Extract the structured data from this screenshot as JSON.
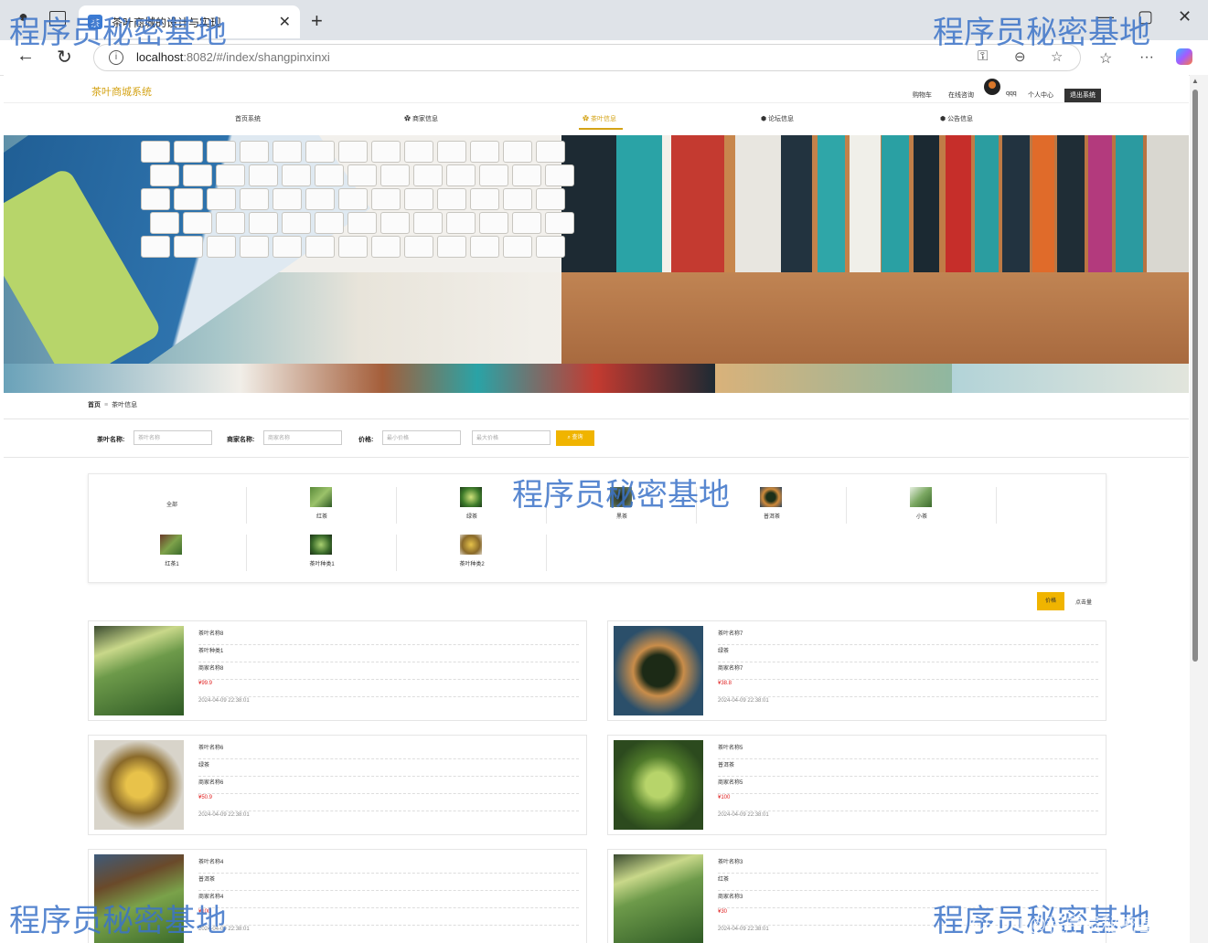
{
  "browser": {
    "tab_title": "茶叶商城的设计与实现",
    "url_host": "localhost",
    "url_rest": ":8082/#/index/shangpinxinxi"
  },
  "site": {
    "title": "茶叶商城系统",
    "top_links": [
      "购物车",
      "在线咨询",
      "qqq",
      "个人中心"
    ],
    "logout": "退出系统",
    "menu": [
      "首页系统",
      "商家信息",
      "茶叶信息",
      "论坛信息",
      "公告信息"
    ],
    "active_menu": "茶叶信息"
  },
  "breadcrumb": {
    "home": "首页",
    "sep": "≡",
    "current": "茶叶信息"
  },
  "search": {
    "name_label": "茶叶名称:",
    "name_placeholder": "茶叶名称",
    "shop_label": "商家名称:",
    "shop_placeholder": "商家名称",
    "price_label": "价格:",
    "min_placeholder": "最小价格",
    "max_placeholder": "最大价格",
    "button": "查询"
  },
  "categories": [
    "全部",
    "红茶",
    "绿茶",
    "黑茶",
    "普洱茶",
    "小茶",
    "红茶1",
    "茶叶种类1",
    "茶叶种类2"
  ],
  "sort": {
    "price": "价格",
    "clicks": "点击量"
  },
  "products": [
    {
      "name": "茶叶名称8",
      "type": "茶叶种类1",
      "shop": "商家名称8",
      "price": "¥99.9",
      "time": "2024-04-09 22:38:01"
    },
    {
      "name": "茶叶名称7",
      "type": "绿茶",
      "shop": "商家名称7",
      "price": "¥38.8",
      "time": "2024-04-09 22:38:01"
    },
    {
      "name": "茶叶名称6",
      "type": "绿茶",
      "shop": "商家名称6",
      "price": "¥50.9",
      "time": "2024-04-09 22:38:01"
    },
    {
      "name": "茶叶名称5",
      "type": "普洱茶",
      "shop": "商家名称5",
      "price": "¥100",
      "time": "2024-04-09 22:38:01"
    },
    {
      "name": "茶叶名称4",
      "type": "普洱茶",
      "shop": "商家名称4",
      "price": "¥100",
      "time": "2024-04-09 22:38:01"
    },
    {
      "name": "茶叶名称3",
      "type": "红茶",
      "shop": "商家名称3",
      "price": "¥30",
      "time": "2024-04-09 22:38:01"
    }
  ],
  "watermark": "程序员秘密基地",
  "csdn_mark": "CSDN @程序员秘密基地",
  "colors": {
    "accent": "#d4a316",
    "button": "#f0b400",
    "price": "#e02020",
    "watermark": "#3b73c8"
  }
}
